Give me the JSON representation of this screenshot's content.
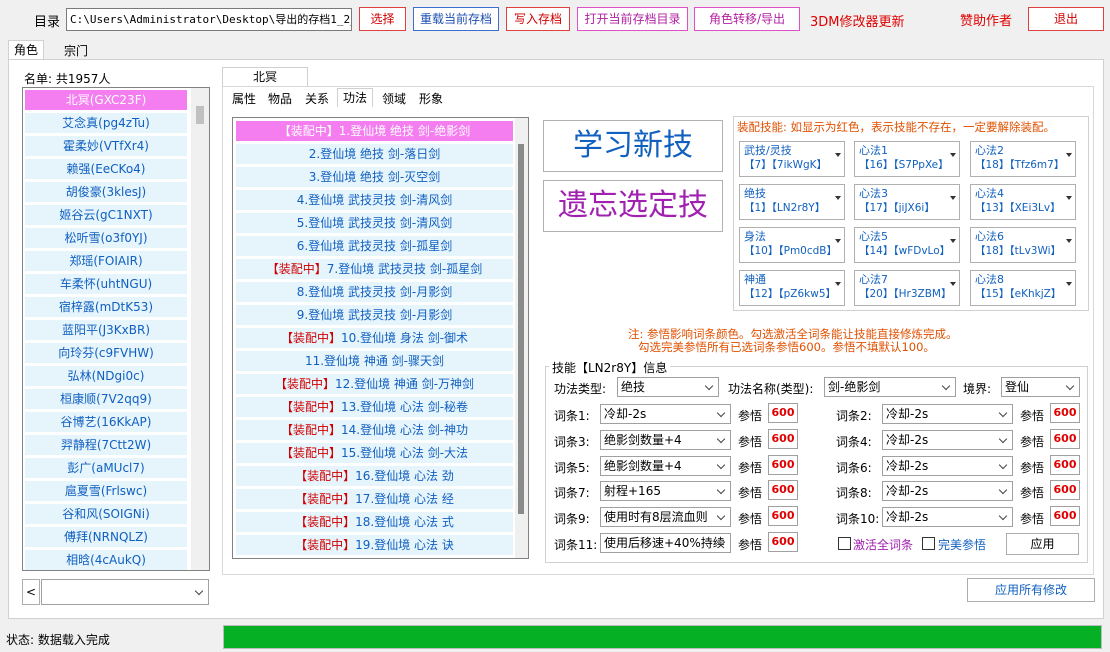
{
  "toolbar": {
    "dir_label": "目录",
    "path_value": "C:\\Users\\Administrator\\Desktop\\导出的存档1_2_20",
    "select_label": "选择",
    "reload_label": "重载当前存档",
    "write_label": "写入存档",
    "open_dir_label": "打开当前存档目录",
    "transfer_label": "角色转移/导出",
    "update_label": "3DM修改器更新",
    "sponsor_label": "赞助作者",
    "exit_label": "退出"
  },
  "main_tabs": [
    "角色",
    "宗门"
  ],
  "roster": {
    "header": "名单: 共1957人",
    "items": [
      "北冥(GXC23F)",
      "艾念真(pg4zTu)",
      "霍柔妙(VTfXr4)",
      "赖强(EeCKo4)",
      "胡俊豪(3klesJ)",
      "姬谷云(gC1NXT)",
      "松听雪(o3f0YJ)",
      "郑瑶(FOIAIR)",
      "车柔怀(uhtNGU)",
      "宿梓露(mDtK53)",
      "蓝阳平(J3KxBR)",
      "向玲芬(c9FVHW)",
      "弘林(NDgi0c)",
      "桓康顺(7V2qq9)",
      "谷博艺(16KkAP)",
      "羿静程(7Ctt2W)",
      "彭广(aMUcl7)",
      "扈夏雪(Frlswc)",
      "谷和风(SOIGNi)",
      "傅拜(NRNQLZ)",
      "相晗(4cAukQ)"
    ],
    "back_label": "<"
  },
  "char_tab": "北冥(GXC23F)",
  "sub_tabs": [
    "属性",
    "物品",
    "关系",
    "功法",
    "领域",
    "形象"
  ],
  "skills": [
    {
      "eq": "【装配中】",
      "text": "1.登仙境 绝技 剑-绝影剑"
    },
    {
      "eq": "",
      "text": "2.登仙境  绝技  剑-落日剑"
    },
    {
      "eq": "",
      "text": "3.登仙境  绝技  剑-灭空剑"
    },
    {
      "eq": "",
      "text": "4.登仙境  武技灵技  剑-清风剑"
    },
    {
      "eq": "",
      "text": "5.登仙境  武技灵技  剑-清风剑"
    },
    {
      "eq": "",
      "text": "6.登仙境  武技灵技  剑-孤星剑"
    },
    {
      "eq": "【装配中】",
      "text": "7.登仙境  武技灵技  剑-孤星剑"
    },
    {
      "eq": "",
      "text": "8.登仙境  武技灵技  剑-月影剑"
    },
    {
      "eq": "",
      "text": "9.登仙境  武技灵技  剑-月影剑"
    },
    {
      "eq": "【装配中】",
      "text": "10.登仙境  身法  剑-御术"
    },
    {
      "eq": "",
      "text": "11.登仙境  神通  剑-骤天剑"
    },
    {
      "eq": "【装配中】",
      "text": "12.登仙境  神通  剑-万神剑"
    },
    {
      "eq": "【装配中】",
      "text": "13.登仙境  心法  剑-秘卷"
    },
    {
      "eq": "【装配中】",
      "text": "14.登仙境  心法  剑-神功"
    },
    {
      "eq": "【装配中】",
      "text": "15.登仙境  心法  剑-大法"
    },
    {
      "eq": "【装配中】",
      "text": "16.登仙境  心法  劲"
    },
    {
      "eq": "【装配中】",
      "text": "17.登仙境  心法  经"
    },
    {
      "eq": "【装配中】",
      "text": "18.登仙境  心法  式"
    },
    {
      "eq": "【装配中】",
      "text": "19.登仙境  心法  诀"
    }
  ],
  "actions": {
    "learn_label": "学习新技",
    "forget_label": "遗忘选定技"
  },
  "equip": {
    "notice": "装配技能: 如显示为红色，表示技能不存在，一定要解除装配。",
    "slots": [
      {
        "title": "武技/灵技",
        "line": "【7】【7ikWgK】"
      },
      {
        "title": "心法1",
        "line": "【16】【S7PpXe】"
      },
      {
        "title": "心法2",
        "line": "【18】【Tfz6m7】"
      },
      {
        "title": "绝技",
        "line": "【1】【LN2r8Y】"
      },
      {
        "title": "心法3",
        "line": "【17】【jiJX6i】"
      },
      {
        "title": "心法4",
        "line": "【13】【XEi3Lv】"
      },
      {
        "title": "身法",
        "line": "【10】【Pm0cdB】"
      },
      {
        "title": "心法5",
        "line": "【14】【wFDvLo】"
      },
      {
        "title": "心法6",
        "line": "【18】【tLv3Wi】"
      },
      {
        "title": "神通",
        "line": "【12】【pZ6kw5】"
      },
      {
        "title": "心法7",
        "line": "【20】【Hr3ZBM】"
      },
      {
        "title": "心法8",
        "line": "【15】【eKhkjZ】"
      }
    ]
  },
  "note": {
    "line1": "注: 参悟影响词条颜色。勾选激活全词条能让技能直接修炼完成。",
    "line2": "勾选完美参悟所有已选词条参悟600。参悟不填默认100。"
  },
  "info": {
    "title": "技能【LN2r8Y】信息",
    "type_label": "功法类型:",
    "type_value": "绝技",
    "name_label": "功法名称(类型):",
    "name_value": "剑-绝影剑",
    "realm_label": "境界:",
    "realm_value": "登仙",
    "insight_label": "参悟",
    "entries": [
      {
        "label": "词条1:",
        "value": "冷却-2s",
        "insight": "600"
      },
      {
        "label": "词条2:",
        "value": "冷却-2s",
        "insight": "600"
      },
      {
        "label": "词条3:",
        "value": "绝影剑数量+4",
        "insight": "600"
      },
      {
        "label": "词条4:",
        "value": "冷却-2s",
        "insight": "600"
      },
      {
        "label": "词条5:",
        "value": "绝影剑数量+4",
        "insight": "600"
      },
      {
        "label": "词条6:",
        "value": "冷却-2s",
        "insight": "600"
      },
      {
        "label": "词条7:",
        "value": "射程+165",
        "insight": "600"
      },
      {
        "label": "词条8:",
        "value": "冷却-2s",
        "insight": "600"
      },
      {
        "label": "词条9:",
        "value": "使用时有8层流血则",
        "insight": "600"
      },
      {
        "label": "词条10:",
        "value": "冷却-2s",
        "insight": "600"
      },
      {
        "label": "词条11:",
        "value": "使用后移速+40%持续",
        "insight": "600"
      }
    ],
    "activate_label": "激活全词条",
    "perfect_label": "完美参悟",
    "apply_label": "应用"
  },
  "apply_all_label": "应用所有修改",
  "status": {
    "text": "状态: 数据载入完成",
    "progress": 1.0
  }
}
